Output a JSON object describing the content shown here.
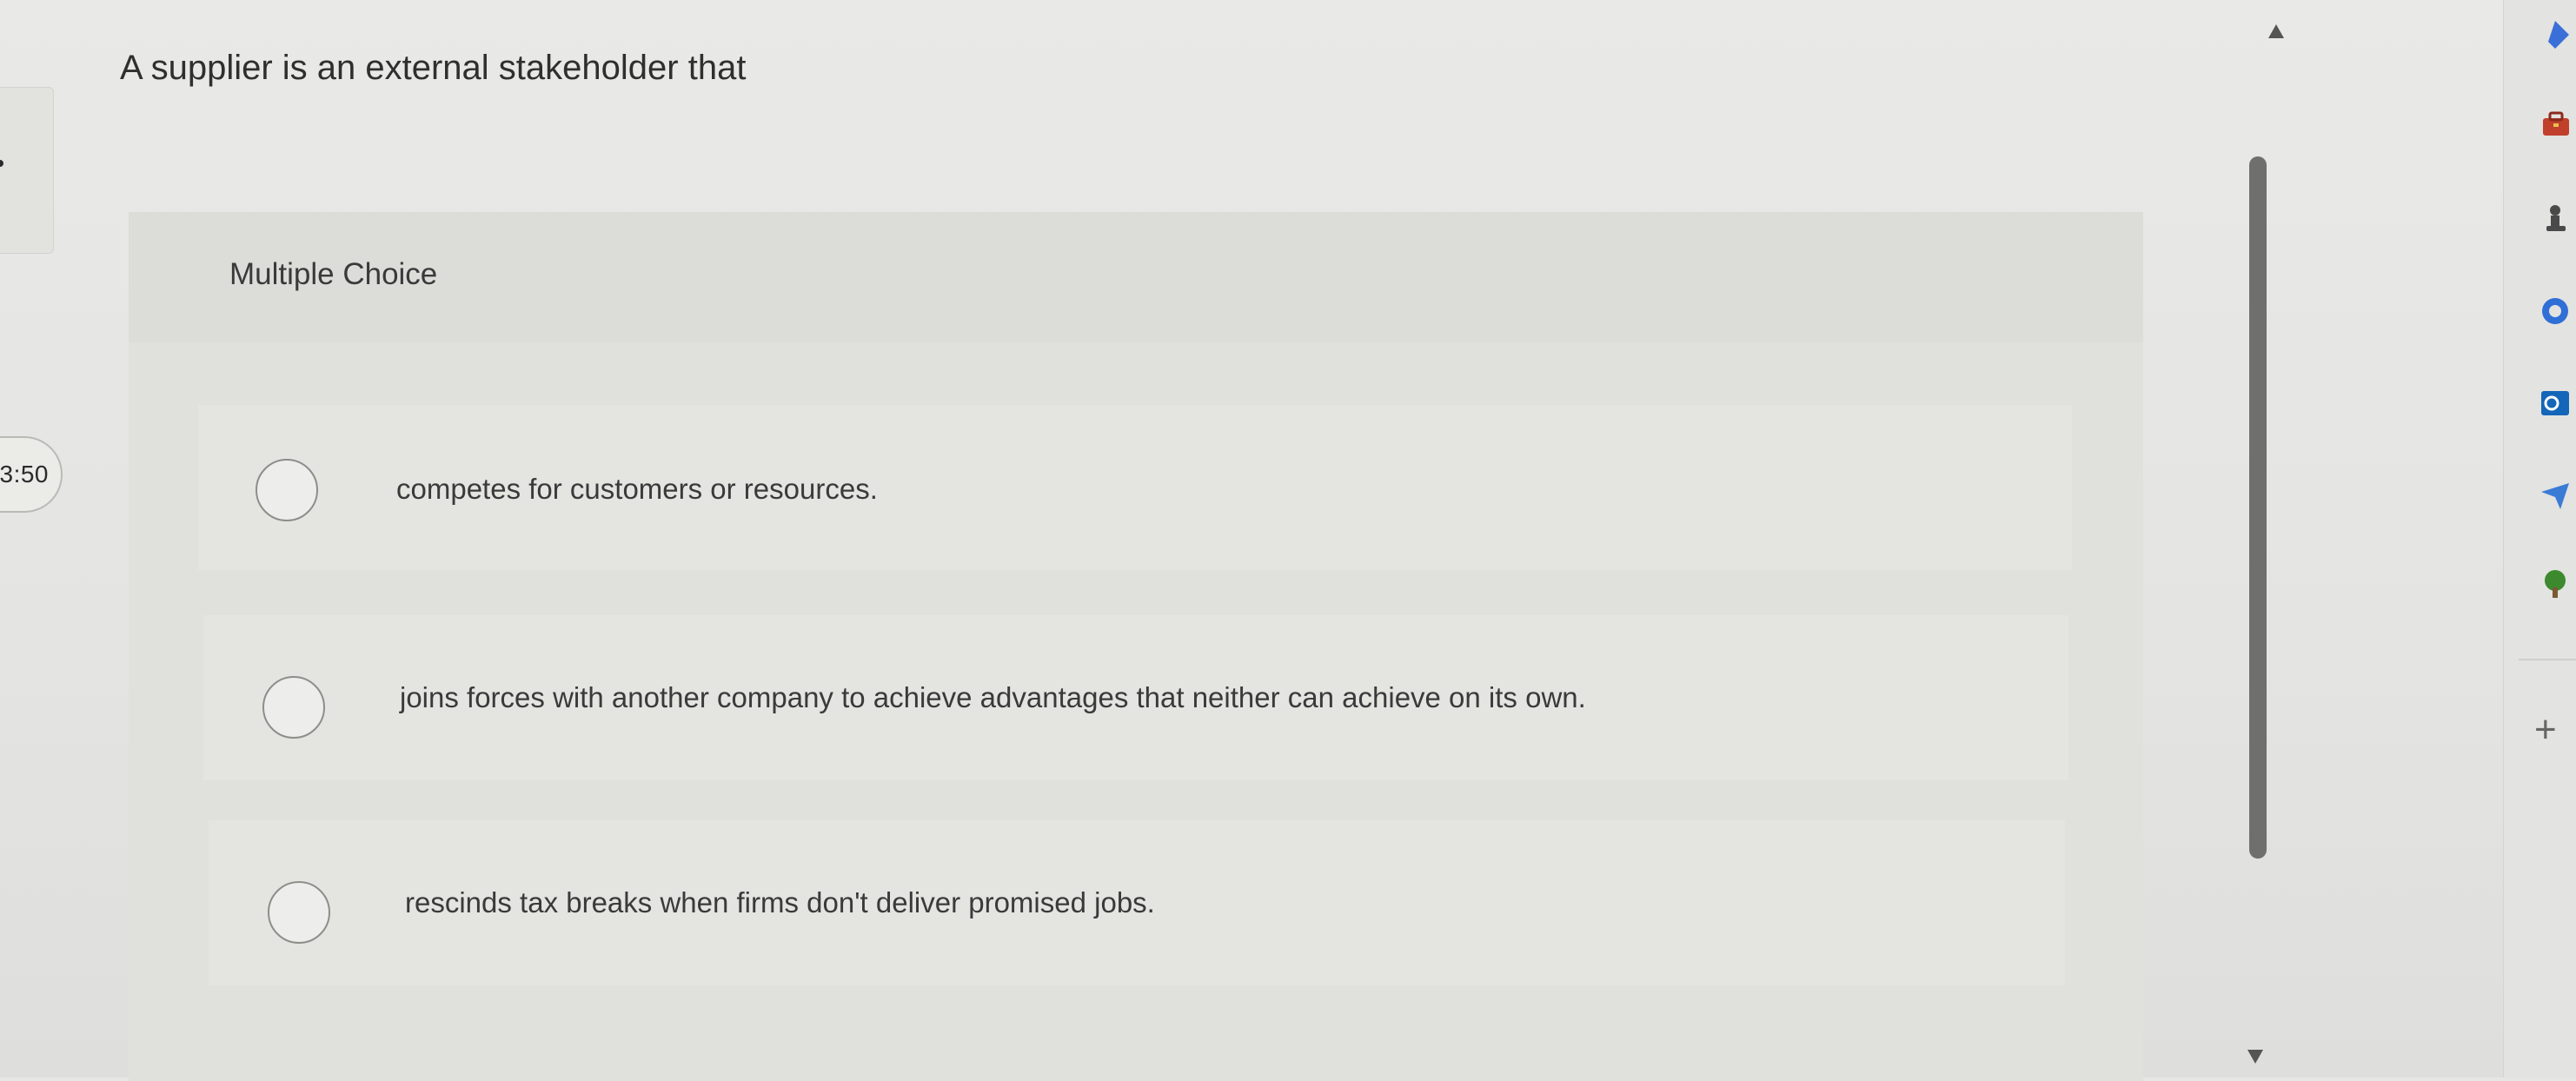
{
  "timer": {
    "text": "3:50"
  },
  "question": {
    "text": "A supplier is an external stakeholder that"
  },
  "multiple_choice": {
    "label": "Multiple Choice",
    "options": [
      {
        "text": "competes for customers or resources."
      },
      {
        "text": "joins forces with another company to achieve advantages that neither can achieve on its own."
      },
      {
        "text": "rescinds tax breaks when firms don't deliver promised jobs."
      }
    ]
  },
  "sidebar": {
    "icons": [
      "copilot-icon",
      "toolbox-icon",
      "chess-icon",
      "office-icon",
      "outlook-icon",
      "send-icon",
      "tree-icon",
      "add-icon"
    ],
    "add_label": "+"
  },
  "colors": {
    "background": "#e6e6e4",
    "panel": "#e0e0dd",
    "scrollbar": "#6f6f6d",
    "outlook_blue": "#1466b8",
    "tree_green": "#3d8a2e"
  }
}
